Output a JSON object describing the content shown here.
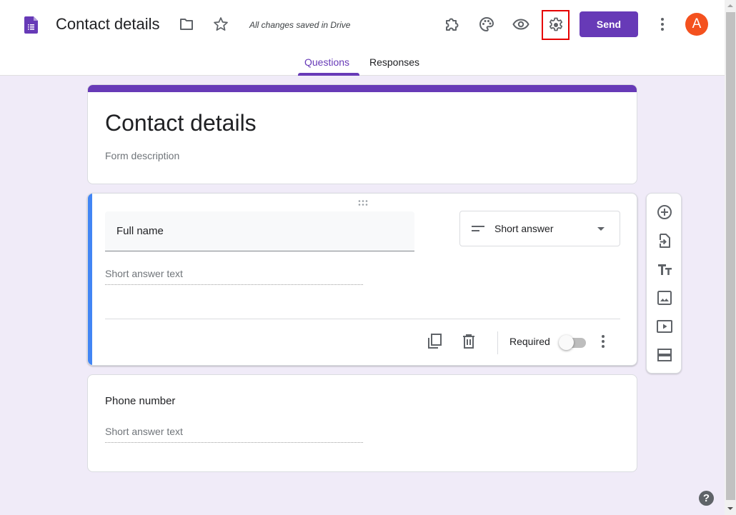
{
  "header": {
    "doc_title": "Contact details",
    "save_status": "All changes saved in Drive",
    "send_label": "Send",
    "avatar_initial": "A",
    "icons": [
      "forms-logo-icon",
      "folder-icon",
      "star-icon",
      "addons-puzzle-icon",
      "palette-icon",
      "preview-eye-icon",
      "settings-gear-icon",
      "more-vert-icon"
    ],
    "highlighted_control": "settings-gear-icon"
  },
  "tabs": [
    {
      "label": "Questions",
      "active": true
    },
    {
      "label": "Responses",
      "active": false
    }
  ],
  "form": {
    "title": "Contact details",
    "description_placeholder": "Form description",
    "questions": [
      {
        "title": "Full name",
        "type": "Short answer",
        "answer_placeholder": "Short answer text",
        "required_label": "Required",
        "required": false,
        "selected": true
      },
      {
        "title": "Phone number",
        "answer_placeholder": "Short answer text",
        "selected": false
      }
    ]
  },
  "side_toolbar": {
    "items": [
      "add-question-icon",
      "import-questions-icon",
      "add-title-icon",
      "add-image-icon",
      "add-video-icon",
      "add-section-icon"
    ]
  },
  "help": {
    "label": "?"
  },
  "colors": {
    "accent": "#673ab7",
    "background": "#f0ebf8",
    "selected_bar": "#4285f4",
    "avatar": "#f4511e",
    "highlight_box": "#e50000"
  }
}
